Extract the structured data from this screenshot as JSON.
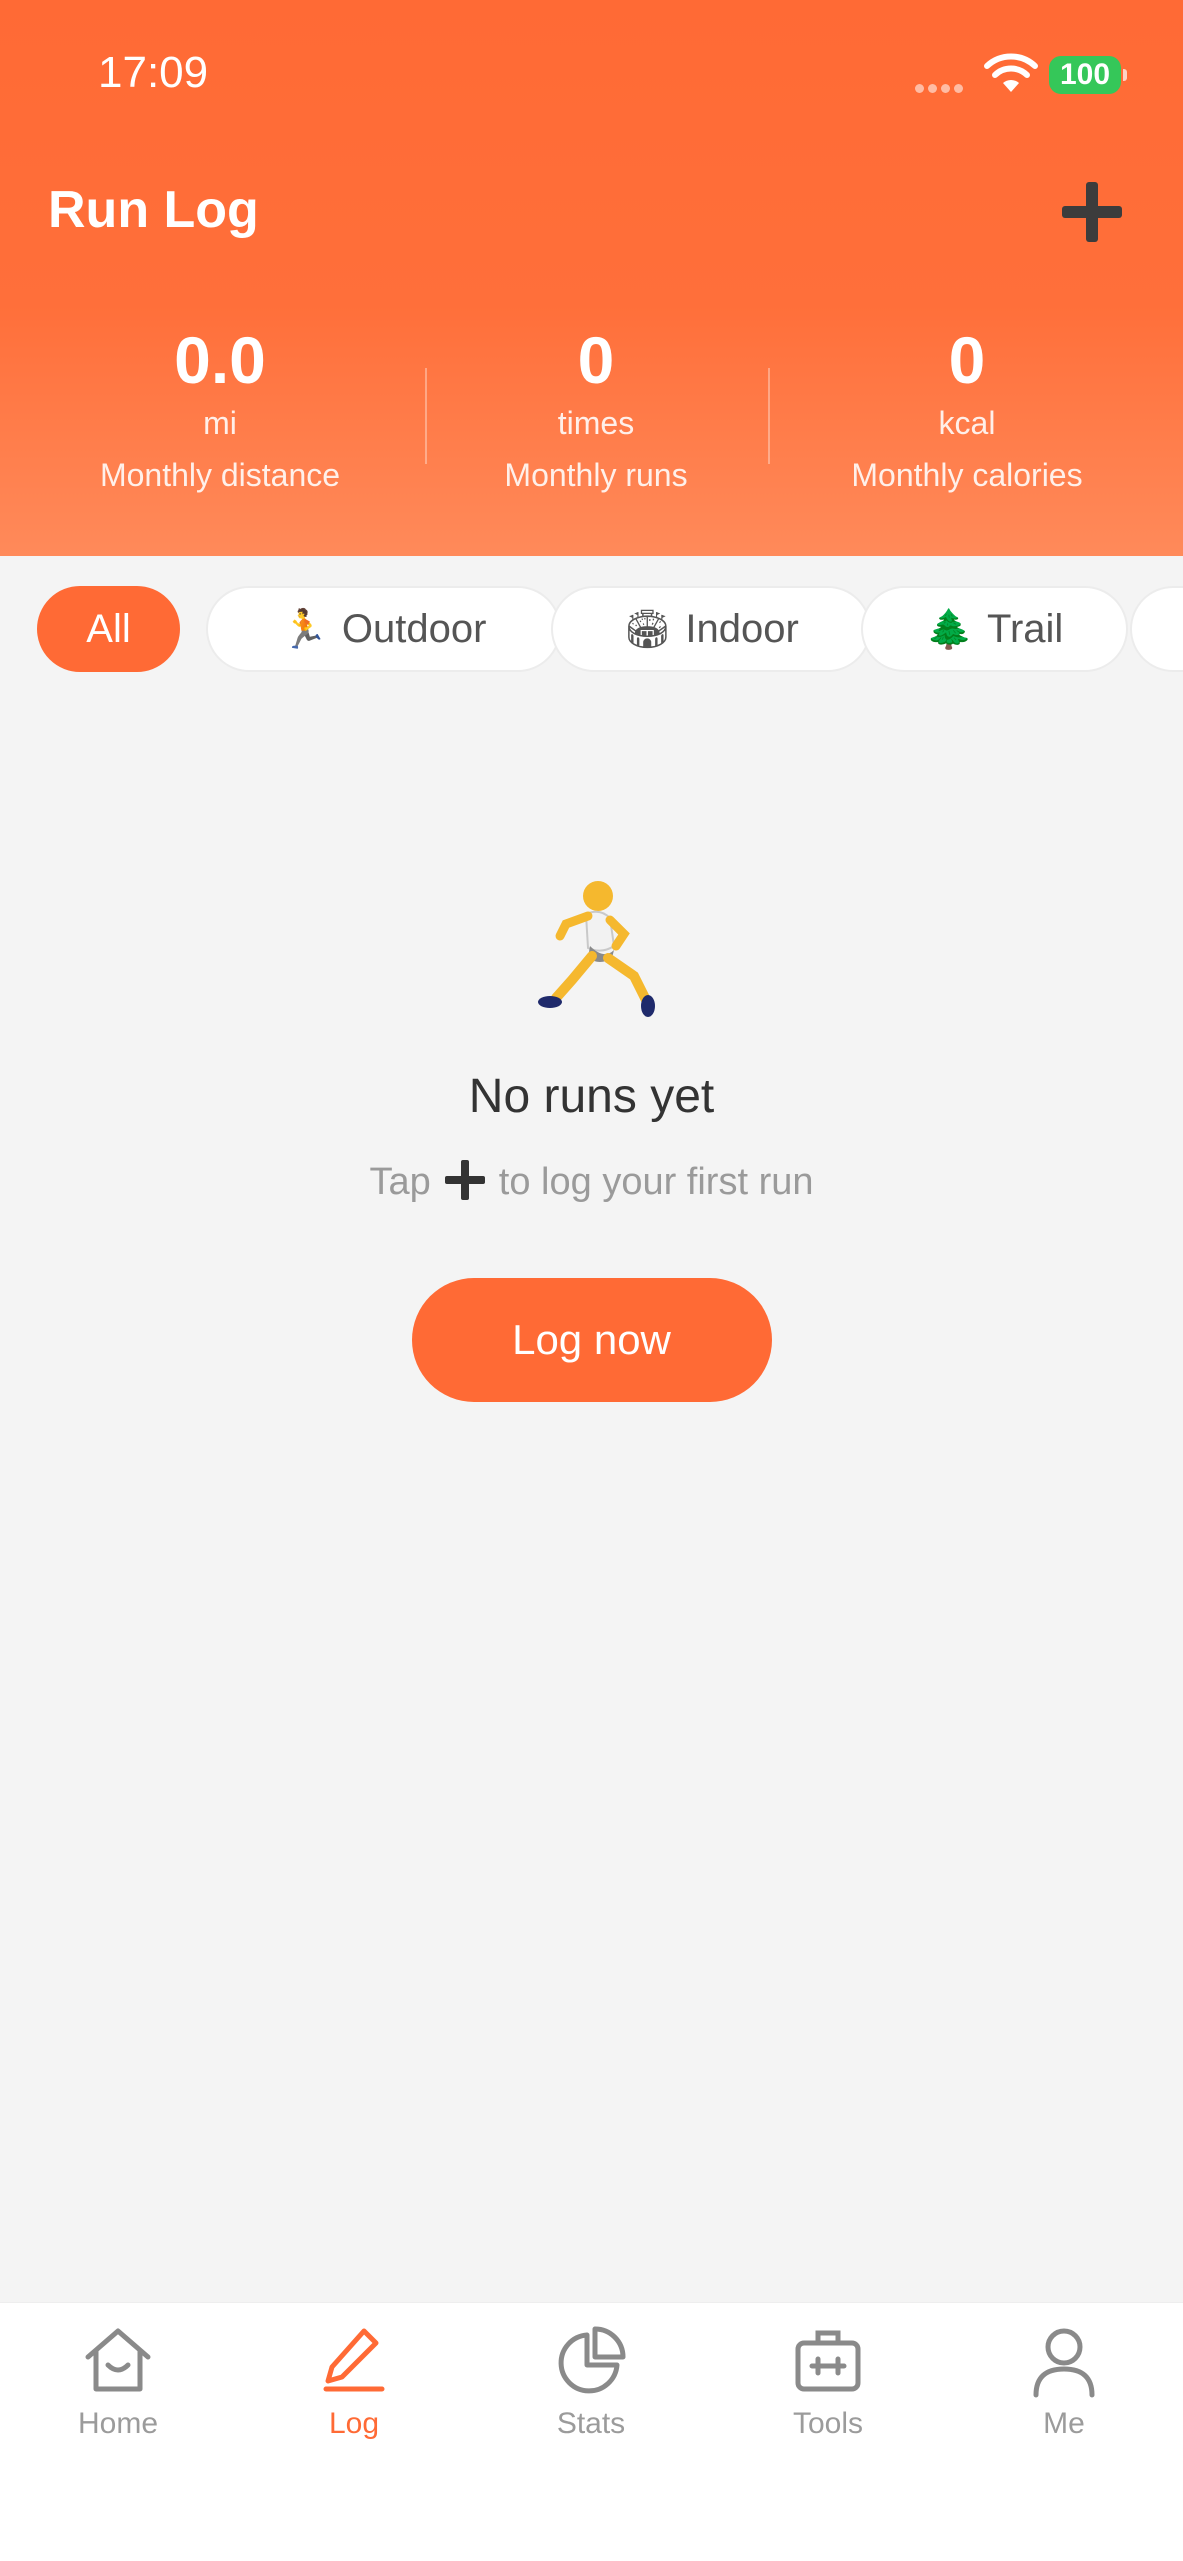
{
  "status_bar": {
    "time": "17:09",
    "battery": "100",
    "wifi_icon": "wifi-icon",
    "signal_icon": "signal-icon"
  },
  "header": {
    "title": "Run Log",
    "add_icon": "plus-icon",
    "stats": [
      {
        "value": "0.0",
        "unit": "mi",
        "label": "Monthly distance"
      },
      {
        "value": "0",
        "unit": "times",
        "label": "Monthly runs"
      },
      {
        "value": "0",
        "unit": "kcal",
        "label": "Monthly calories"
      }
    ]
  },
  "filters": [
    {
      "emoji": "",
      "label": "All",
      "active": true
    },
    {
      "emoji": "🏃",
      "label": "Outdoor"
    },
    {
      "emoji": "🏟",
      "label": "Indoor"
    },
    {
      "emoji": "🌲",
      "label": "Trail"
    }
  ],
  "empty_state": {
    "icon": "runner-icon",
    "title": "No runs yet",
    "subtitle_before": "Tap",
    "subtitle_after": "to log your first run",
    "button": "Log now"
  },
  "tabbar": [
    {
      "label": "Home",
      "icon": "home-icon"
    },
    {
      "label": "Log",
      "icon": "pencil-icon",
      "active": true
    },
    {
      "label": "Stats",
      "icon": "pie-chart-icon"
    },
    {
      "label": "Tools",
      "icon": "toolbox-icon"
    },
    {
      "label": "Me",
      "icon": "person-icon"
    }
  ],
  "colors": {
    "accent": "#ff6a35",
    "background": "#f4f4f4",
    "battery": "#35c759"
  }
}
